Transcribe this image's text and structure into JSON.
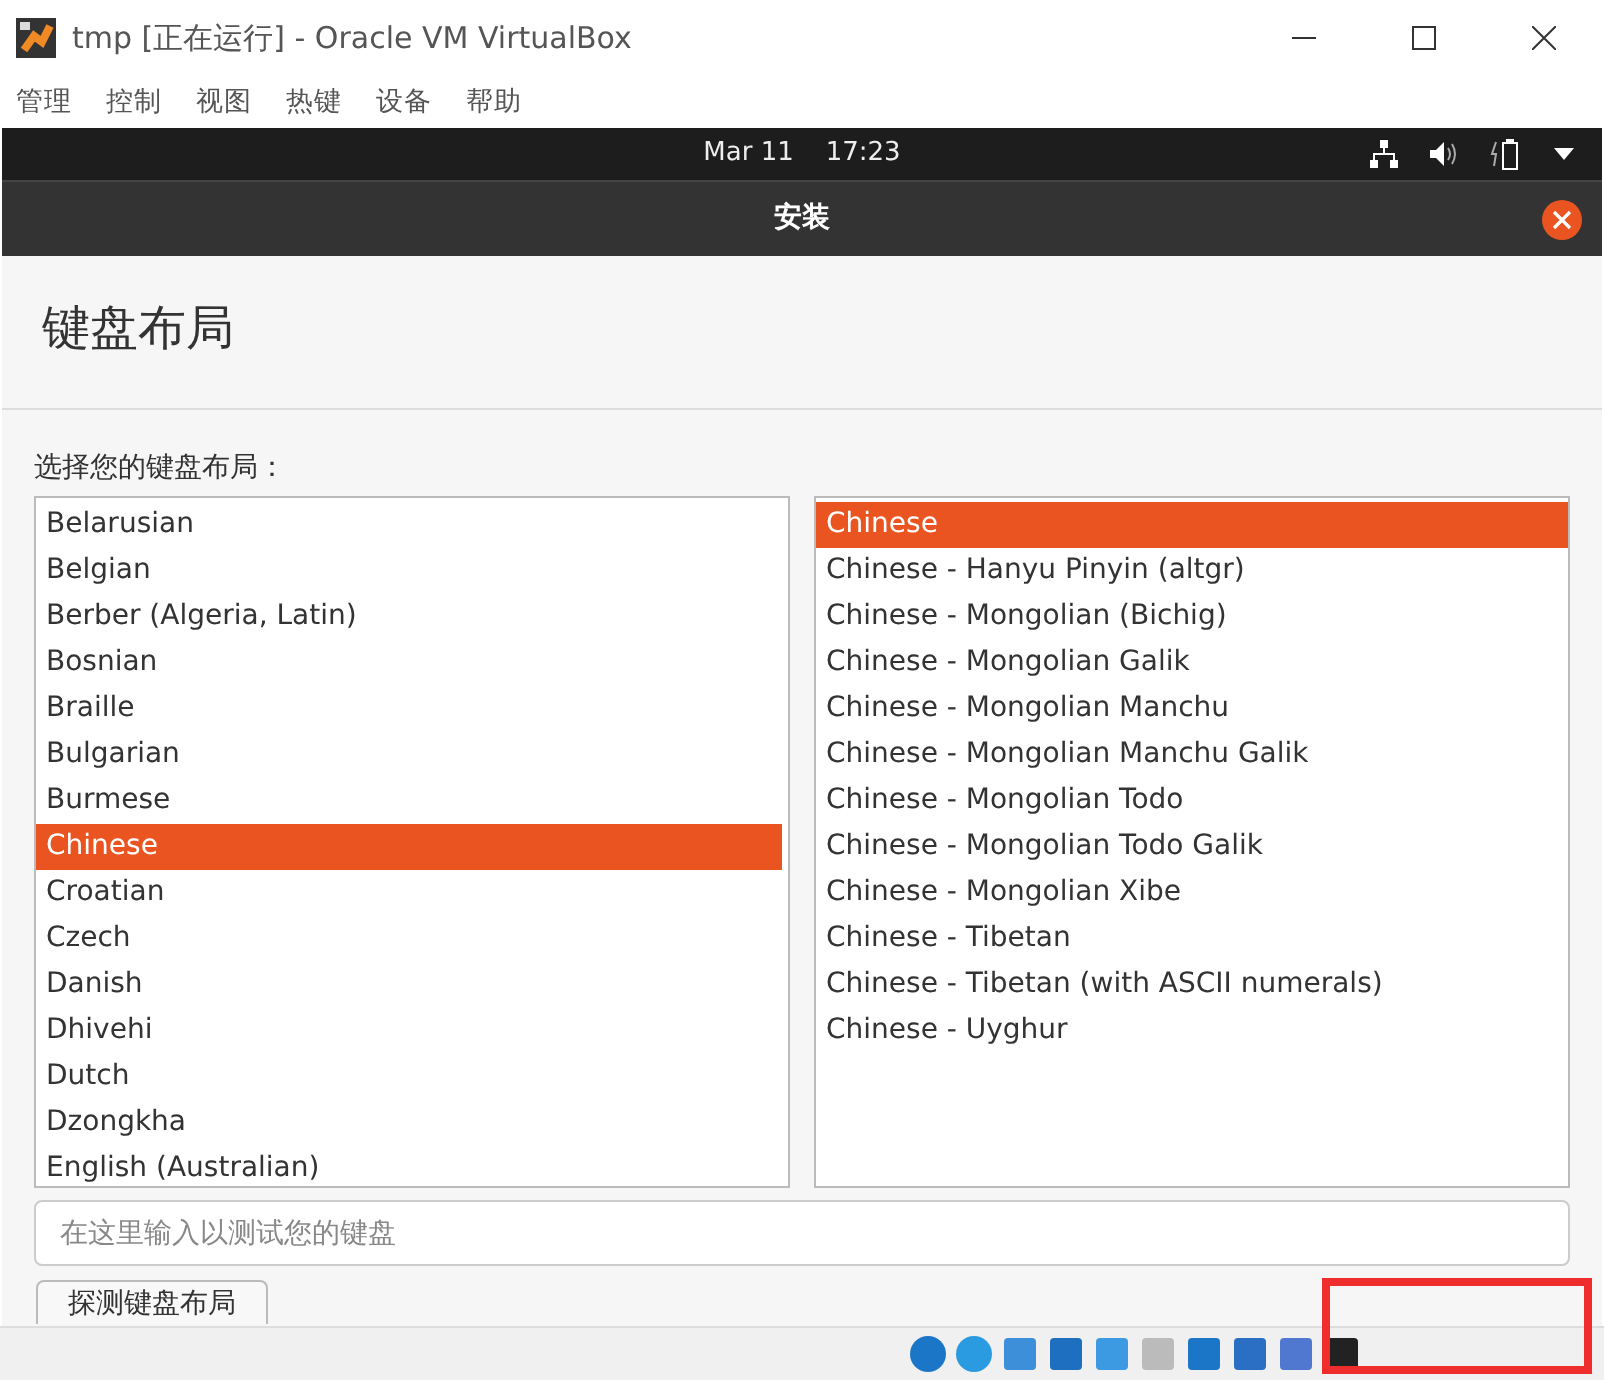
{
  "window": {
    "title": "tmp [正在运行] - Oracle VM VirtualBox"
  },
  "menu": [
    "管理",
    "控制",
    "视图",
    "热键",
    "设备",
    "帮助"
  ],
  "top_panel": {
    "date": "Mar 11",
    "time": "17:23"
  },
  "dialog": {
    "title": "安装",
    "heading": "键盘布局",
    "prompt": "选择您的键盘布局："
  },
  "layouts": [
    {
      "label": "Belarusian",
      "selected": false
    },
    {
      "label": "Belgian",
      "selected": false
    },
    {
      "label": "Berber (Algeria, Latin)",
      "selected": false
    },
    {
      "label": "Bosnian",
      "selected": false
    },
    {
      "label": "Braille",
      "selected": false
    },
    {
      "label": "Bulgarian",
      "selected": false
    },
    {
      "label": "Burmese",
      "selected": false
    },
    {
      "label": "Chinese",
      "selected": true
    },
    {
      "label": "Croatian",
      "selected": false
    },
    {
      "label": "Czech",
      "selected": false
    },
    {
      "label": "Danish",
      "selected": false
    },
    {
      "label": "Dhivehi",
      "selected": false
    },
    {
      "label": "Dutch",
      "selected": false
    },
    {
      "label": "Dzongkha",
      "selected": false
    },
    {
      "label": "English (Australian)",
      "selected": false
    }
  ],
  "variants": [
    {
      "label": "Chinese",
      "selected": true
    },
    {
      "label": "Chinese - Hanyu Pinyin (altgr)",
      "selected": false
    },
    {
      "label": "Chinese - Mongolian (Bichig)",
      "selected": false
    },
    {
      "label": "Chinese - Mongolian Galik",
      "selected": false
    },
    {
      "label": "Chinese - Mongolian Manchu",
      "selected": false
    },
    {
      "label": "Chinese - Mongolian Manchu Galik",
      "selected": false
    },
    {
      "label": "Chinese - Mongolian Todo",
      "selected": false
    },
    {
      "label": "Chinese - Mongolian Todo Galik",
      "selected": false
    },
    {
      "label": "Chinese - Mongolian Xibe",
      "selected": false
    },
    {
      "label": "Chinese - Tibetan",
      "selected": false
    },
    {
      "label": "Chinese - Tibetan (with ASCII numerals)",
      "selected": false
    },
    {
      "label": "Chinese - Uyghur",
      "selected": false
    }
  ],
  "test_field": {
    "placeholder": "在这里输入以测试您的键盘"
  },
  "detect_button": {
    "label": "探测键盘布局"
  }
}
